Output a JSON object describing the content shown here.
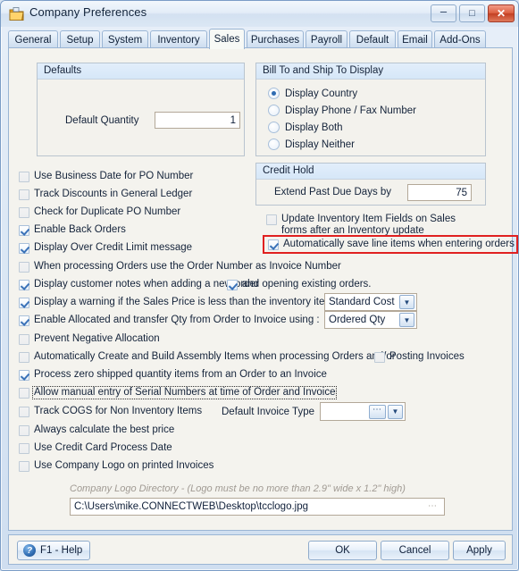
{
  "window": {
    "title": "Company Preferences",
    "icon": "company-preferences-icon",
    "minimize_label": "–",
    "maximize_label": "□",
    "close_label": "✕"
  },
  "tabs": [
    {
      "label": "General",
      "active": false
    },
    {
      "label": "Setup",
      "active": false
    },
    {
      "label": "System",
      "active": false
    },
    {
      "label": "Inventory",
      "active": false
    },
    {
      "label": "Sales",
      "active": true
    },
    {
      "label": "Purchases",
      "active": false
    },
    {
      "label": "Payroll",
      "active": false
    },
    {
      "label": "Default",
      "active": false
    },
    {
      "label": "Email",
      "active": false
    },
    {
      "label": "Add-Ons",
      "active": false
    }
  ],
  "defaults_group": {
    "title": "Defaults",
    "quantity_label": "Default Quantity",
    "quantity_value": "1"
  },
  "bill_ship_group": {
    "title": "Bill To and Ship To Display",
    "options": [
      {
        "label": "Display Country",
        "selected": true
      },
      {
        "label": "Display Phone / Fax Number",
        "selected": false
      },
      {
        "label": "Display Both",
        "selected": false
      },
      {
        "label": "Display Neither",
        "selected": false
      }
    ]
  },
  "credit_hold_group": {
    "title": "Credit Hold",
    "extend_label": "Extend Past Due Days by",
    "extend_value": "75"
  },
  "right_checkboxes": [
    {
      "label": "Update Inventory Item Fields on Sales",
      "checked": false
    },
    {
      "label": "Automatically save line items when entering orders",
      "checked": true
    }
  ],
  "right_continuation_line": "forms after an Inventory update",
  "left_checkboxes": [
    {
      "label": "Use Business Date for PO Number",
      "checked": false
    },
    {
      "label": "Track Discounts in General Ledger",
      "checked": false
    },
    {
      "label": "Check for Duplicate PO Number",
      "checked": false
    },
    {
      "label": "Enable Back Orders",
      "checked": true
    },
    {
      "label": "Display Over Credit Limit message",
      "checked": true
    },
    {
      "label": "When processing Orders use the Order Number as Invoice Number",
      "checked": false
    },
    {
      "label": "Display customer notes when adding a new order",
      "checked": true
    },
    {
      "label": "Display a warning if the Sales Price is less than the inventory items",
      "checked": true
    },
    {
      "label": "Enable Allocated and transfer Qty from Order to Invoice using :",
      "checked": true
    },
    {
      "label": "Prevent Negative Allocation",
      "checked": false
    },
    {
      "label": "Automatically Create and Build Assembly Items when processing Orders and/or",
      "checked": false
    },
    {
      "label": "Process zero shipped quantity items from an Order to an Invoice",
      "checked": true
    },
    {
      "label": "Allow manual entry of Serial Numbers at time of Order and Invoice",
      "checked": false,
      "focused": true
    },
    {
      "label": "Track COGS for Non Inventory Items",
      "checked": false
    },
    {
      "label": "Always calculate the best price",
      "checked": false
    },
    {
      "label": "Use Credit Card Process Date",
      "checked": false
    },
    {
      "label": "Use Company Logo on printed Invoices",
      "checked": false
    }
  ],
  "inline_checkboxes": {
    "opening_existing_orders": {
      "label": "and opening existing orders.",
      "checked": true
    },
    "posting_invoices": {
      "label": "Posting Invoices",
      "checked": false
    }
  },
  "combos": {
    "cost_method": {
      "value": "Standard Cost"
    },
    "qty_method": {
      "value": "Ordered Qty"
    },
    "default_invoice_type": {
      "label": "Default Invoice Type",
      "value": ""
    }
  },
  "logo": {
    "hint": "Company Logo Directory - (Logo must be no more than 2.9\" wide x 1.2\" high)",
    "path": "C:\\Users\\mike.CONNECTWEB\\Desktop\\tcclogo.jpg",
    "browse_label": "⋯"
  },
  "buttons": {
    "help": "F1 - Help",
    "help_icon_glyph": "?",
    "ok": "OK",
    "cancel": "Cancel",
    "apply": "Apply"
  },
  "colors": {
    "accent": "#2f6cb2",
    "highlight": "#e02020",
    "panel": "#f4f3ee",
    "titlebar": "#dce8f5"
  }
}
